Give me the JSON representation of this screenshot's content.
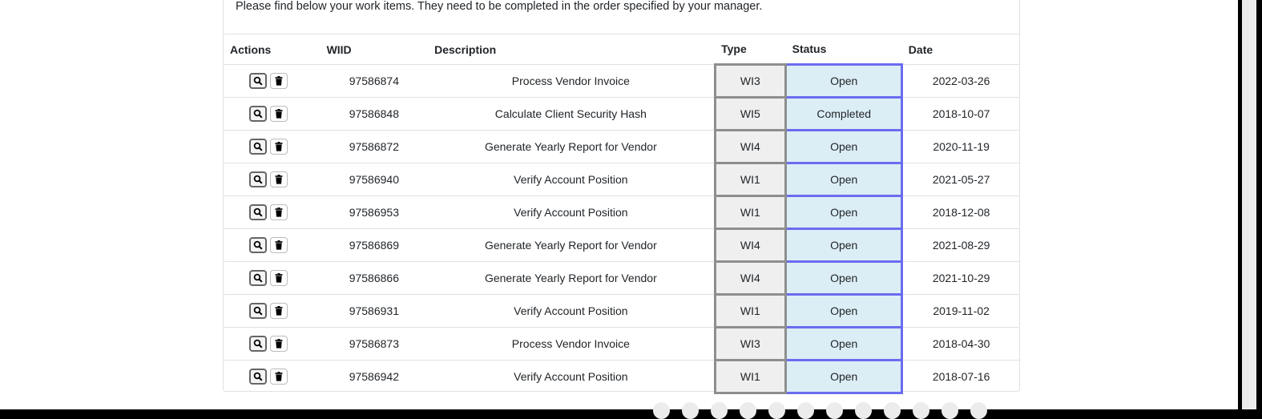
{
  "intro": "Please find below your work items. They need to be completed in the order specified by your manager.",
  "headers": {
    "actions": "Actions",
    "wiid": "WIID",
    "description": "Description",
    "type": "Type",
    "status": "Status",
    "date": "Date"
  },
  "rows": [
    {
      "wiid": "97586874",
      "description": "Process Vendor Invoice",
      "type": "WI3",
      "status": "Open",
      "date": "2022-03-26"
    },
    {
      "wiid": "97586848",
      "description": "Calculate Client Security Hash",
      "type": "WI5",
      "status": "Completed",
      "date": "2018-10-07"
    },
    {
      "wiid": "97586872",
      "description": "Generate Yearly Report for Vendor",
      "type": "WI4",
      "status": "Open",
      "date": "2020-11-19"
    },
    {
      "wiid": "97586940",
      "description": "Verify Account Position",
      "type": "WI1",
      "status": "Open",
      "date": "2021-05-27"
    },
    {
      "wiid": "97586953",
      "description": "Verify Account Position",
      "type": "WI1",
      "status": "Open",
      "date": "2018-12-08"
    },
    {
      "wiid": "97586869",
      "description": "Generate Yearly Report for Vendor",
      "type": "WI4",
      "status": "Open",
      "date": "2021-08-29"
    },
    {
      "wiid": "97586866",
      "description": "Generate Yearly Report for Vendor",
      "type": "WI4",
      "status": "Open",
      "date": "2021-10-29"
    },
    {
      "wiid": "97586931",
      "description": "Verify Account Position",
      "type": "WI1",
      "status": "Open",
      "date": "2019-11-02"
    },
    {
      "wiid": "97586873",
      "description": "Process Vendor Invoice",
      "type": "WI3",
      "status": "Open",
      "date": "2018-04-30"
    },
    {
      "wiid": "97586942",
      "description": "Verify Account Position",
      "type": "WI1",
      "status": "Open",
      "date": "2018-07-16"
    }
  ],
  "icons": {
    "view": "search-icon",
    "delete": "trash-icon"
  },
  "colors": {
    "type_bg": "#efefef",
    "type_border": "#8e8e8e",
    "status_bg": "#dceef5",
    "status_border": "#6a6cf0"
  }
}
